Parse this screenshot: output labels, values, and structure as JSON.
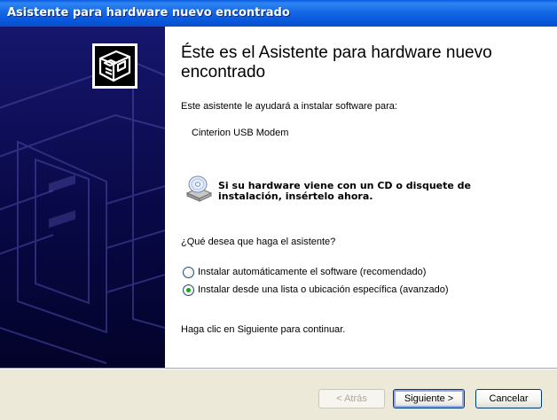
{
  "window": {
    "title": "Asistente para hardware nuevo encontrado"
  },
  "content": {
    "heading": "Éste es el Asistente para hardware nuevo encontrado",
    "intro": "Este asistente le ayudará a instalar software para:",
    "device_name": "Cinterion USB Modem",
    "cd_notice_line1": "Si su hardware viene con un CD o disquete de",
    "cd_notice_line2": "instalación, insértelo ahora.",
    "question": "¿Qué desea que haga el asistente?",
    "options": [
      {
        "label": "Instalar automáticamente el software (recomendado)",
        "selected": false
      },
      {
        "label": "Instalar desde una lista o ubicación específica (avanzado)",
        "selected": true
      }
    ],
    "continue_text": "Haga clic en Siguiente para continuar."
  },
  "footer": {
    "back_label": "< Atrás",
    "next_label": "Siguiente >",
    "cancel_label": "Cancelar"
  },
  "colors": {
    "titlebar": "#0a5ae0",
    "sidebar": "#080846",
    "footer": "#ece9d8"
  },
  "icons": [
    "hardware-wizard-icon",
    "cd-drive-icon"
  ]
}
